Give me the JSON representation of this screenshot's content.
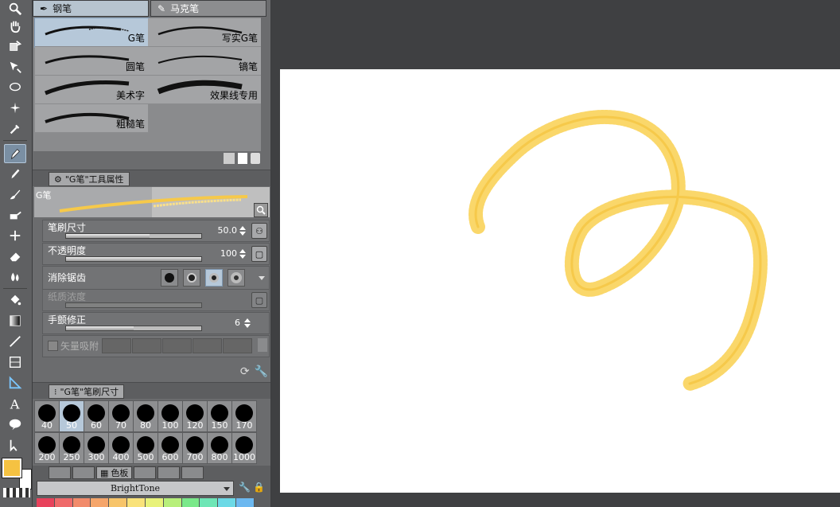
{
  "subtool_tabs": [
    {
      "label": "钢笔",
      "icon": "pen-nib-icon"
    },
    {
      "label": "马克笔",
      "icon": "marker-icon"
    }
  ],
  "brushes": [
    {
      "label": "G笔"
    },
    {
      "label": "写实G笔"
    },
    {
      "label": "圆笔"
    },
    {
      "label": "镝笔"
    },
    {
      "label": "美术字"
    },
    {
      "label": "效果线专用"
    },
    {
      "label": "粗糙笔"
    }
  ],
  "tool_property": {
    "panel_title": "\"G笔\"工具属性",
    "preview_label": "G笔",
    "brush_size": {
      "label": "笔刷尺寸",
      "value": "50.0",
      "fraction": 0.62
    },
    "opacity": {
      "label": "不透明度",
      "value": "100",
      "fraction": 1.0
    },
    "antialiasing": {
      "label": "消除锯齿"
    },
    "paper_texture": {
      "label": "纸质浓度"
    },
    "stabilization": {
      "label": "手颤修正",
      "value": "6",
      "fraction": 0.5
    },
    "vector_snap": {
      "label": "矢量吸附"
    }
  },
  "brush_size_panel": {
    "title": "\"G笔\"笔刷尺寸",
    "sizes_row1": [
      "40",
      "50",
      "60",
      "70",
      "80",
      "100",
      "120",
      "150",
      "170"
    ],
    "sizes_row2": [
      "200",
      "250",
      "300",
      "400",
      "500",
      "600",
      "700",
      "800",
      "1000"
    ],
    "selected": "50"
  },
  "color_set": {
    "tab_label": "色板",
    "set_name": "BrightTone",
    "palette": [
      "#e8425c",
      "#ef6a6a",
      "#f28b6b",
      "#f5a56a",
      "#f7c46a",
      "#f9e27a",
      "#e8f27a",
      "#b7ef7a",
      "#7ae98a",
      "#6ee6b6",
      "#6cd9e6",
      "#6cb8f0"
    ]
  },
  "colors": {
    "main_color": "#f5c242",
    "sub_color": "#ffffff",
    "stroke": "#fad76a",
    "stroke_inner": "#f6c94a"
  }
}
